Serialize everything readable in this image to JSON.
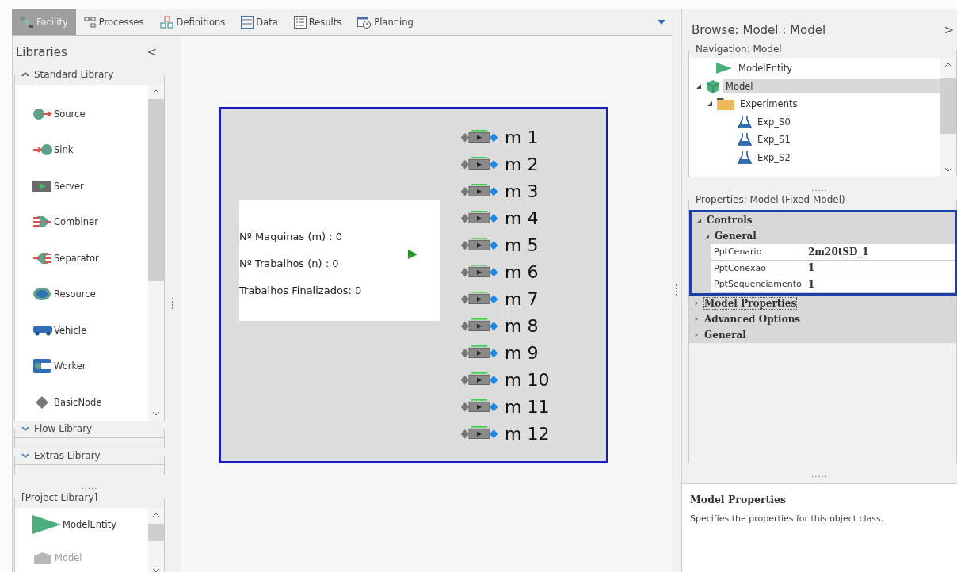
{
  "tabs": [
    {
      "label": "Facility",
      "selected": true
    },
    {
      "label": "Processes",
      "selected": false
    },
    {
      "label": "Definitions",
      "selected": false
    },
    {
      "label": "Data",
      "selected": false
    },
    {
      "label": "Results",
      "selected": false
    },
    {
      "label": "Planning",
      "selected": false
    }
  ],
  "libraries": {
    "title": "Libraries",
    "collapse": "<",
    "groups": [
      {
        "title": "Standard Library",
        "expanded": true,
        "items": [
          "Source",
          "Sink",
          "Server",
          "Combiner",
          "Separator",
          "Resource",
          "Vehicle",
          "Worker",
          "BasicNode"
        ]
      },
      {
        "title": "Flow Library",
        "expanded": false
      },
      {
        "title": "Extras Library",
        "expanded": false
      }
    ],
    "splitter": ".....",
    "project": {
      "title": "[Project Library]",
      "items": [
        "ModelEntity",
        "Model"
      ]
    }
  },
  "canvas": {
    "counters": [
      "Nº Maquinas (m) : 0",
      "Nº Trabalhos (n) : 0",
      "Trabalhos Finalizados: 0"
    ],
    "machines": [
      "m 1",
      "m 2",
      "m 3",
      "m 4",
      "m 5",
      "m 6",
      "m 7",
      "m 8",
      "m 9",
      "m 10",
      "m 11",
      "m 12"
    ]
  },
  "browse": {
    "title": "Browse: Model : Model",
    "toggle": ">",
    "navigation": {
      "title": "Navigation: Model",
      "tree": [
        {
          "label": "ModelEntity",
          "selected": false
        },
        {
          "label": "Model",
          "selected": true,
          "expanded": true,
          "children": [
            {
              "label": "Experiments",
              "selected": false,
              "expanded": true,
              "children": [
                {
                  "label": "Exp_S0",
                  "selected": false
                },
                {
                  "label": "Exp_S1",
                  "selected": false
                },
                {
                  "label": "Exp_S2",
                  "selected": false
                }
              ]
            }
          ]
        }
      ]
    },
    "splitter": ".....",
    "properties": {
      "title": "Properties: Model (Fixed Model)",
      "categories": [
        {
          "label": "Controls",
          "expanded": true,
          "highlighted": true,
          "focused": false,
          "groups": [
            {
              "label": "General",
              "expanded": true,
              "rows": [
                {
                  "name": "PptCenario",
                  "value": "2m20tSD_1"
                },
                {
                  "name": "PptConexao",
                  "value": "1"
                },
                {
                  "name": "PptSequenciamento",
                  "value": "1"
                }
              ]
            }
          ]
        },
        {
          "label": "Model Properties",
          "expanded": false,
          "highlighted": false,
          "focused": true
        },
        {
          "label": "Advanced Options",
          "expanded": false,
          "highlighted": false,
          "focused": false
        },
        {
          "label": "General",
          "expanded": false,
          "highlighted": false,
          "focused": false
        }
      ]
    },
    "splitter2": ".....",
    "description": {
      "title": "Model Properties",
      "text": "Specifies the properties for this object class."
    }
  }
}
